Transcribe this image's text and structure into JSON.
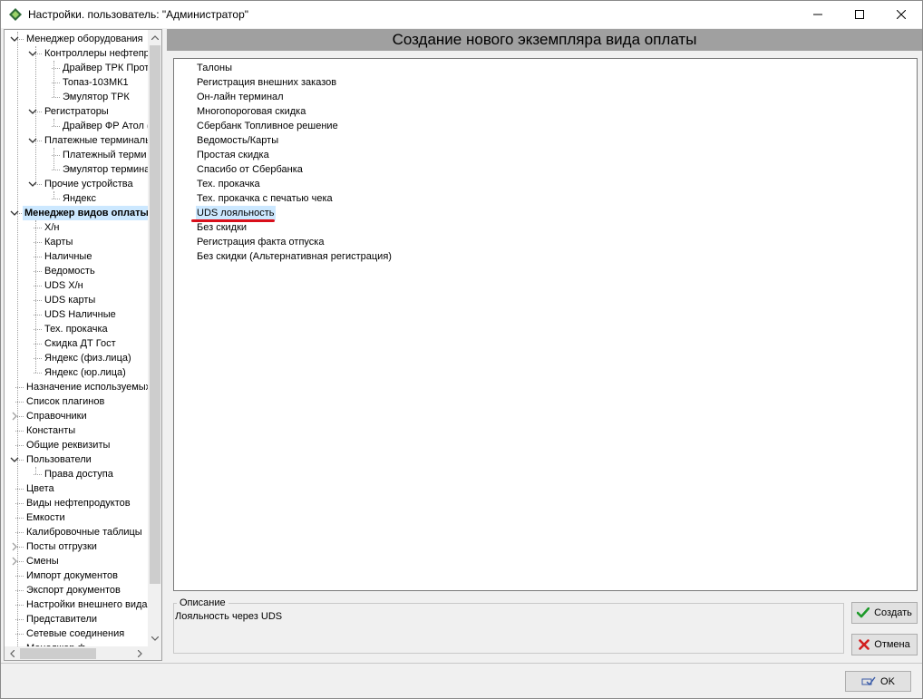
{
  "window": {
    "title": "Настройки. пользователь: \"Администратор\""
  },
  "tree": {
    "items": [
      {
        "label": "Менеджер оборудования",
        "level": 0,
        "expanded": true,
        "has_children": true
      },
      {
        "label": "Контроллеры нефтепр",
        "level": 1,
        "expanded": true,
        "has_children": true
      },
      {
        "label": "Драйвер ТРК Прот",
        "level": 2
      },
      {
        "label": "Топаз-103МК1",
        "level": 2
      },
      {
        "label": "Эмулятор ТРК",
        "level": 2
      },
      {
        "label": "Регистраторы",
        "level": 1,
        "expanded": true,
        "has_children": true
      },
      {
        "label": "Драйвер ФР Атол (",
        "level": 2
      },
      {
        "label": "Платежные терминалы",
        "level": 1,
        "expanded": true,
        "has_children": true
      },
      {
        "label": "Платежный терми",
        "level": 2
      },
      {
        "label": "Эмулятор термина",
        "level": 2
      },
      {
        "label": "Прочие устройства",
        "level": 1,
        "expanded": true,
        "has_children": true
      },
      {
        "label": "Яндекс",
        "level": 2
      },
      {
        "label": "Менеджер видов оплаты",
        "level": 0,
        "expanded": true,
        "has_children": true,
        "selected": true
      },
      {
        "label": "Х/н",
        "level": 1
      },
      {
        "label": "Карты",
        "level": 1
      },
      {
        "label": "Наличные",
        "level": 1
      },
      {
        "label": "Ведомость",
        "level": 1
      },
      {
        "label": "UDS Х/н",
        "level": 1
      },
      {
        "label": "UDS карты",
        "level": 1
      },
      {
        "label": "UDS Наличные",
        "level": 1
      },
      {
        "label": "Тех. прокачка",
        "level": 1
      },
      {
        "label": "Скидка ДТ Гост",
        "level": 1
      },
      {
        "label": "Яндекс (физ.лица)",
        "level": 1
      },
      {
        "label": "Яндекс (юр.лица)",
        "level": 1
      },
      {
        "label": "Назначение используемых",
        "level": 0
      },
      {
        "label": "Список плагинов",
        "level": 0
      },
      {
        "label": "Справочники",
        "level": 0,
        "has_children": true,
        "expanded": false
      },
      {
        "label": "Константы",
        "level": 0
      },
      {
        "label": "Общие реквизиты",
        "level": 0
      },
      {
        "label": "Пользователи",
        "level": 0,
        "expanded": true,
        "has_children": true
      },
      {
        "label": "Права доступа",
        "level": 1
      },
      {
        "label": "Цвета",
        "level": 0
      },
      {
        "label": "Виды нефтепродуктов",
        "level": 0
      },
      {
        "label": "Емкости",
        "level": 0
      },
      {
        "label": "Калибровочные таблицы",
        "level": 0
      },
      {
        "label": "Посты отгрузки",
        "level": 0,
        "has_children": true,
        "expanded": false
      },
      {
        "label": "Смены",
        "level": 0,
        "has_children": true,
        "expanded": false
      },
      {
        "label": "Импорт документов",
        "level": 0
      },
      {
        "label": "Экспорт документов",
        "level": 0
      },
      {
        "label": "Настройки внешнего вида",
        "level": 0
      },
      {
        "label": "Представители",
        "level": 0
      },
      {
        "label": "Сетевые соединения",
        "level": 0
      },
      {
        "label": "Менеджер ф",
        "level": 0
      }
    ]
  },
  "main": {
    "header": "Создание нового экземпляра вида оплаты",
    "list": [
      "Талоны",
      "Регистрация внешних заказов",
      "Он-лайн терминал",
      "Многопороговая скидка",
      "Сбербанк Топливное решение",
      "Ведомость/Карты",
      "Простая скидка",
      "Спасибо от Сбербанка",
      "Тех. прокачка",
      "Тех. прокачка с печатью чека",
      "UDS лояльность",
      "Без скидки",
      "Регистрация факта отпуска",
      "Без скидки (Альтернативная регистрация)"
    ],
    "selected_index": 10,
    "description_label": "Описание",
    "description_text": "Лояльность через UDS"
  },
  "buttons": {
    "create": "Создать",
    "cancel": "Отмена",
    "ok": "OK"
  },
  "colors": {
    "selection": "#cce8ff",
    "header_bar": "#a0a0a0",
    "annotation_underline": "#d90f1a",
    "create_icon": "#1e9a2a",
    "cancel_icon": "#d21f1f"
  }
}
